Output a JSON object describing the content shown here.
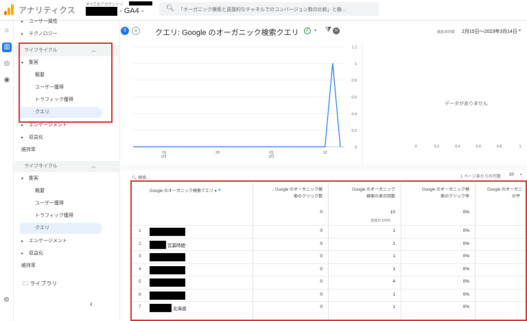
{
  "app": {
    "title": "アナリティクス",
    "account_label": "すべてのアカウント >",
    "property": "- GA4 -",
    "search_placeholder": "「オーガニック検索と直接的なチャネルでのコンバージョン数の比較」と検..."
  },
  "nav": {
    "items_top": [
      {
        "label": "ユーザー属性",
        "arrow": "▸"
      },
      {
        "label": "テクノロジー",
        "arrow": "▸"
      }
    ],
    "lifecycle_1": {
      "section": "ライフサイクル",
      "group": "集客",
      "subitems": [
        "概要",
        "ユーザー獲得",
        "トラフィック獲得",
        "クエリ"
      ],
      "after": [
        {
          "label": "エンゲージメント",
          "arrow": "▸"
        },
        {
          "label": "収益化",
          "arrow": "▸"
        },
        {
          "label": "維持率",
          "arrow": ""
        }
      ]
    },
    "lifecycle_2": {
      "section": "ライフサイクル",
      "group": "集客",
      "subitems": [
        "概要",
        "ユーザー獲得",
        "トラフィック獲得",
        "クエリ"
      ],
      "after": [
        {
          "label": "エンゲージメント",
          "arrow": "▸"
        },
        {
          "label": "収益化",
          "arrow": "▸"
        },
        {
          "label": "維持率",
          "arrow": ""
        }
      ]
    },
    "library": "ライブラリ"
  },
  "report": {
    "badge": "9",
    "title": "クエリ: Google のオーガニック検索クエリ",
    "period_label": "過去28日間",
    "date_range": "2月15日～2023年3月14日"
  },
  "chart_data": [
    {
      "type": "line",
      "x_tick_labels": [
        {
          "day": "19",
          "month": "2月"
        },
        {
          "day": "26",
          "month": ""
        },
        {
          "day": "05",
          "month": "3月"
        },
        {
          "day": "12",
          "month": ""
        }
      ],
      "x": [
        "02-15",
        "02-16",
        "02-17",
        "02-18",
        "02-19",
        "02-20",
        "02-21",
        "02-22",
        "02-23",
        "02-24",
        "02-25",
        "02-26",
        "02-27",
        "02-28",
        "03-01",
        "03-02",
        "03-03",
        "03-04",
        "03-05",
        "03-06",
        "03-07",
        "03-08",
        "03-09",
        "03-10",
        "03-11",
        "03-12",
        "03-13",
        "03-14"
      ],
      "series": [
        {
          "color": "#1a73e8",
          "values": [
            0,
            0,
            0,
            0,
            0,
            0,
            0,
            0,
            0,
            0,
            0,
            0,
            0,
            0,
            0,
            0,
            0,
            0,
            0,
            0,
            0,
            0,
            0,
            0,
            0,
            0,
            1,
            0
          ]
        }
      ],
      "y_ticks": [
        "0",
        "0.2",
        "0.4",
        "0.6",
        "0.8",
        "1",
        "1.2"
      ],
      "ylim": [
        0,
        1.2
      ]
    },
    {
      "type": "scatter",
      "message": "データがありません",
      "x_ticks": [
        "0",
        "0.2",
        "0.4",
        "0.6",
        "0.8",
        "1"
      ],
      "xlim": [
        0,
        1
      ]
    }
  ],
  "table": {
    "search_placeholder": "検索...",
    "rows_per_page_label": "1 ページあたりの行数",
    "rows_per_page": "10",
    "columns": [
      {
        "l1": "Google のオーガニック検索クエリ",
        "l2": ""
      },
      {
        "l1": "↓ Google のオーガニック検",
        "l2": "索のクリック数"
      },
      {
        "l1": "Google のオーガニック",
        "l2": "検索の表示回数"
      },
      {
        "l1": "Google のオーガニック検",
        "l2": "索のクリック率"
      },
      {
        "l1": "Google のオーガニ",
        "l2": "の平"
      }
    ],
    "totals": {
      "clicks": "0",
      "impr": "10",
      "impr_sub": "全体の 100%",
      "ctr": "0%"
    },
    "rows": [
      {
        "idx": "1",
        "suffix": "",
        "clicks": "0",
        "impr": "1",
        "ctr": "0%"
      },
      {
        "idx": "2",
        "suffix": "営業時間",
        "clicks": "0",
        "impr": "1",
        "ctr": "0%"
      },
      {
        "idx": "3",
        "suffix": "",
        "clicks": "0",
        "impr": "1",
        "ctr": "0%"
      },
      {
        "idx": "4",
        "suffix": "",
        "clicks": "0",
        "impr": "1",
        "ctr": "0%"
      },
      {
        "idx": "5",
        "suffix": "",
        "clicks": "0",
        "impr": "4",
        "ctr": "0%"
      },
      {
        "idx": "6",
        "suffix": "",
        "clicks": "0",
        "impr": "1",
        "ctr": "0%"
      },
      {
        "idx": "7",
        "suffix": "北海道",
        "clicks": "0",
        "impr": "1",
        "ctr": "0%"
      }
    ]
  },
  "colors": {
    "accent": "#1a73e8",
    "highlight": "#d32f2f",
    "selected_bg": "#e8f0fe"
  }
}
